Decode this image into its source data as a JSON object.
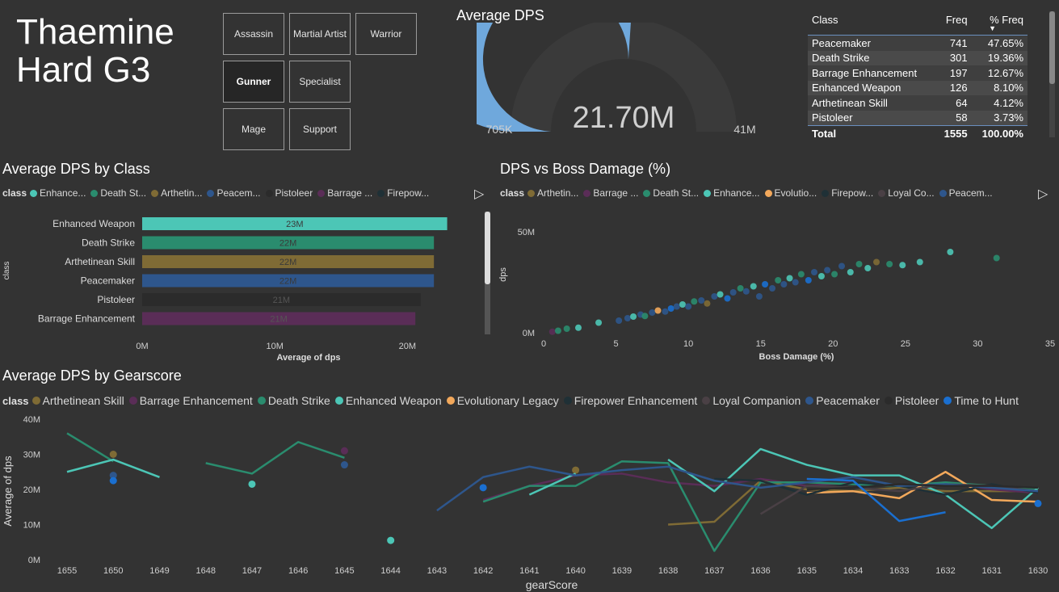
{
  "page_title_line1": "Thaemine",
  "page_title_line2": "Hard G3",
  "slicer": {
    "buttons": [
      {
        "label": "Assassin",
        "selected": false
      },
      {
        "label": "Martial Artist",
        "selected": false
      },
      {
        "label": "Warrior",
        "selected": false
      },
      {
        "label": "Gunner",
        "selected": true
      },
      {
        "label": "Specialist",
        "selected": false
      },
      {
        "label": "Mage",
        "selected": false
      },
      {
        "label": "Support",
        "selected": false
      }
    ]
  },
  "gauge": {
    "title": "Average DPS",
    "value_label": "21.70M",
    "min_label": "705K",
    "max_label": "41M",
    "value": 21700000,
    "min": 705000,
    "max": 41000000,
    "color": "#6fa8dc"
  },
  "freq_table": {
    "headers": [
      "Class",
      "Freq",
      "% Freq"
    ],
    "rows": [
      {
        "class": "Peacemaker",
        "freq": "741",
        "pct": "47.65%"
      },
      {
        "class": "Death Strike",
        "freq": "301",
        "pct": "19.36%"
      },
      {
        "class": "Barrage Enhancement",
        "freq": "197",
        "pct": "12.67%"
      },
      {
        "class": "Enhanced Weapon",
        "freq": "126",
        "pct": "8.10%"
      },
      {
        "class": "Arthetinean Skill",
        "freq": "64",
        "pct": "4.12%"
      },
      {
        "class": "Pistoleer",
        "freq": "58",
        "pct": "3.73%"
      }
    ],
    "total": {
      "label": "Total",
      "freq": "1555",
      "pct": "100.00%"
    }
  },
  "colors": {
    "Arthetinean Skill": "#7f6b35",
    "Barrage Enhancement": "#5a2d57",
    "Death Strike": "#2a8c6e",
    "Enhanced Weapon": "#4cc6b6",
    "Evolutionary Legacy": "#f2a85b",
    "Firepower Enhancement": "#1f3036",
    "Loyal Companion": "#4a4045",
    "Peacemaker": "#2e568c",
    "Pistoleer": "#2b2b2b",
    "Time to Hunt": "#1a6fd0"
  },
  "bar_chart": {
    "title": "Average DPS by Class",
    "legend_title": "class",
    "legend_items": [
      "Enhance...",
      "Death St...",
      "Arthetin...",
      "Peacem...",
      "Pistoleer",
      "Barrage ...",
      "Firepow..."
    ],
    "legend_keys": [
      "Enhanced Weapon",
      "Death Strike",
      "Arthetinean Skill",
      "Peacemaker",
      "Pistoleer",
      "Barrage Enhancement",
      "Firepower Enhancement"
    ]
  },
  "scatter_chart": {
    "title": "DPS vs Boss Damage (%)",
    "legend_title": "class",
    "legend_items": [
      "Arthetin...",
      "Barrage ...",
      "Death St...",
      "Enhance...",
      "Evolutio...",
      "Firepow...",
      "Loyal Co...",
      "Peacem..."
    ],
    "legend_keys": [
      "Arthetinean Skill",
      "Barrage Enhancement",
      "Death Strike",
      "Enhanced Weapon",
      "Evolutionary Legacy",
      "Firepower Enhancement",
      "Loyal Companion",
      "Peacemaker"
    ]
  },
  "line_chart": {
    "title": "Average DPS by Gearscore",
    "legend_title": "class",
    "legend_items": [
      "Arthetinean Skill",
      "Barrage Enhancement",
      "Death Strike",
      "Enhanced Weapon",
      "Evolutionary Legacy",
      "Firepower Enhancement",
      "Loyal Companion",
      "Peacemaker",
      "Pistoleer",
      "Time to Hunt"
    ]
  },
  "chart_data": [
    {
      "type": "bar",
      "orientation": "horizontal",
      "title": "Average DPS by Class",
      "categories": [
        "Enhanced Weapon",
        "Death Strike",
        "Arthetinean Skill",
        "Peacemaker",
        "Pistoleer",
        "Barrage Enhancement"
      ],
      "values": [
        23000000,
        22000000,
        22000000,
        22000000,
        21000000,
        20600000
      ],
      "data_labels": [
        "23M",
        "22M",
        "22M",
        "22M",
        "21M",
        "21M"
      ],
      "xlabel": "Average of dps",
      "ylabel": "class",
      "x_ticks": [
        "0M",
        "10M",
        "20M"
      ],
      "xlim": [
        0,
        24000000
      ]
    },
    {
      "type": "scatter",
      "title": "DPS vs Boss Damage (%)",
      "xlabel": "Boss Damage (%)",
      "ylabel": "dps",
      "xlim": [
        0,
        35
      ],
      "ylim": [
        0,
        50000000
      ],
      "x_ticks": [
        "0",
        "5",
        "10",
        "15",
        "20",
        "25",
        "30",
        "35"
      ],
      "y_ticks": [
        "0M",
        "50M"
      ],
      "points": [
        {
          "x": 0.6,
          "y": 0.5,
          "c": "Barrage Enhancement"
        },
        {
          "x": 1.0,
          "y": 1.0,
          "c": "Death Strike"
        },
        {
          "x": 1.6,
          "y": 2.0,
          "c": "Death Strike"
        },
        {
          "x": 2.4,
          "y": 2.5,
          "c": "Enhanced Weapon"
        },
        {
          "x": 3.8,
          "y": 5.0,
          "c": "Enhanced Weapon"
        },
        {
          "x": 5.2,
          "y": 6.0,
          "c": "Peacemaker"
        },
        {
          "x": 5.8,
          "y": 7.2,
          "c": "Peacemaker"
        },
        {
          "x": 6.2,
          "y": 8.0,
          "c": "Enhanced Weapon"
        },
        {
          "x": 6.7,
          "y": 9.0,
          "c": "Peacemaker"
        },
        {
          "x": 7.0,
          "y": 8.3,
          "c": "Death Strike"
        },
        {
          "x": 7.5,
          "y": 10.0,
          "c": "Peacemaker"
        },
        {
          "x": 7.9,
          "y": 11.0,
          "c": "Evolutionary Legacy"
        },
        {
          "x": 8.4,
          "y": 10.5,
          "c": "Peacemaker"
        },
        {
          "x": 8.8,
          "y": 12.0,
          "c": "Time to Hunt"
        },
        {
          "x": 9.2,
          "y": 13.0,
          "c": "Peacemaker"
        },
        {
          "x": 9.6,
          "y": 14.0,
          "c": "Enhanced Weapon"
        },
        {
          "x": 10.0,
          "y": 13.0,
          "c": "Peacemaker"
        },
        {
          "x": 10.4,
          "y": 15.5,
          "c": "Death Strike"
        },
        {
          "x": 10.9,
          "y": 16.0,
          "c": "Peacemaker"
        },
        {
          "x": 11.3,
          "y": 14.5,
          "c": "Arthetinean Skill"
        },
        {
          "x": 11.8,
          "y": 18.0,
          "c": "Peacemaker"
        },
        {
          "x": 12.2,
          "y": 19.0,
          "c": "Enhanced Weapon"
        },
        {
          "x": 12.7,
          "y": 17.0,
          "c": "Time to Hunt"
        },
        {
          "x": 13.1,
          "y": 20.0,
          "c": "Peacemaker"
        },
        {
          "x": 13.6,
          "y": 22.0,
          "c": "Death Strike"
        },
        {
          "x": 14.0,
          "y": 20.5,
          "c": "Peacemaker"
        },
        {
          "x": 14.5,
          "y": 23.0,
          "c": "Enhanced Weapon"
        },
        {
          "x": 14.9,
          "y": 18.0,
          "c": "Peacemaker"
        },
        {
          "x": 15.3,
          "y": 24.0,
          "c": "Time to Hunt"
        },
        {
          "x": 15.8,
          "y": 22.0,
          "c": "Peacemaker"
        },
        {
          "x": 16.2,
          "y": 26.0,
          "c": "Death Strike"
        },
        {
          "x": 16.6,
          "y": 24.0,
          "c": "Peacemaker"
        },
        {
          "x": 17.0,
          "y": 27.0,
          "c": "Enhanced Weapon"
        },
        {
          "x": 17.4,
          "y": 25.0,
          "c": "Peacemaker"
        },
        {
          "x": 17.8,
          "y": 29.0,
          "c": "Death Strike"
        },
        {
          "x": 18.3,
          "y": 26.0,
          "c": "Time to Hunt"
        },
        {
          "x": 18.7,
          "y": 30.0,
          "c": "Peacemaker"
        },
        {
          "x": 19.2,
          "y": 28.0,
          "c": "Enhanced Weapon"
        },
        {
          "x": 19.6,
          "y": 31.0,
          "c": "Peacemaker"
        },
        {
          "x": 20.1,
          "y": 29.0,
          "c": "Death Strike"
        },
        {
          "x": 20.6,
          "y": 33.0,
          "c": "Peacemaker"
        },
        {
          "x": 21.2,
          "y": 30.0,
          "c": "Enhanced Weapon"
        },
        {
          "x": 21.8,
          "y": 34.0,
          "c": "Death Strike"
        },
        {
          "x": 22.4,
          "y": 32.0,
          "c": "Enhanced Weapon"
        },
        {
          "x": 23.0,
          "y": 35.0,
          "c": "Arthetinean Skill"
        },
        {
          "x": 23.9,
          "y": 34.0,
          "c": "Death Strike"
        },
        {
          "x": 24.8,
          "y": 33.5,
          "c": "Enhanced Weapon"
        },
        {
          "x": 26.0,
          "y": 35.0,
          "c": "Enhanced Weapon"
        },
        {
          "x": 28.1,
          "y": 40.0,
          "c": "Enhanced Weapon"
        },
        {
          "x": 31.3,
          "y": 37.0,
          "c": "Death Strike"
        }
      ]
    },
    {
      "type": "line",
      "title": "Average DPS by Gearscore",
      "xlabel": "gearScore",
      "ylabel": "Average of dps",
      "categories": [
        "1655",
        "1650",
        "1649",
        "1648",
        "1647",
        "1646",
        "1645",
        "1644",
        "1643",
        "1642",
        "1641",
        "1640",
        "1639",
        "1638",
        "1637",
        "1636",
        "1635",
        "1634",
        "1633",
        "1632",
        "1631",
        "1630"
      ],
      "ylim": [
        0,
        40
      ],
      "y_ticks": [
        "0M",
        "10M",
        "20M",
        "30M",
        "40M"
      ],
      "series": [
        {
          "name": "Arthetinean Skill",
          "values": [
            null,
            30,
            null,
            null,
            null,
            null,
            null,
            null,
            null,
            null,
            null,
            25.5,
            null,
            10,
            10.8,
            22.5,
            20,
            19.5,
            20.5,
            19.5,
            19.5,
            19.5
          ]
        },
        {
          "name": "Barrage Enhancement",
          "values": [
            null,
            null,
            null,
            null,
            null,
            null,
            31,
            null,
            null,
            17,
            21,
            24,
            24.5,
            22,
            21,
            23,
            21,
            22,
            21,
            22,
            20,
            19
          ]
        },
        {
          "name": "Death Strike",
          "values": [
            36,
            28,
            null,
            27.5,
            24.5,
            33.5,
            29,
            null,
            null,
            16.5,
            21,
            21,
            28,
            27.5,
            2.5,
            22,
            22,
            21.5,
            21,
            22,
            21,
            20
          ]
        },
        {
          "name": "Enhanced Weapon",
          "values": [
            25,
            28.5,
            23.5,
            null,
            21.5,
            null,
            null,
            5.5,
            null,
            null,
            18.5,
            24.5,
            null,
            28.5,
            19.5,
            31.5,
            27,
            24,
            24,
            18.5,
            9,
            20.5
          ]
        },
        {
          "name": "Evolutionary Legacy",
          "values": [
            null,
            null,
            null,
            null,
            null,
            null,
            null,
            null,
            null,
            null,
            null,
            null,
            null,
            null,
            null,
            null,
            19,
            19.5,
            17.5,
            25,
            17,
            16.5
          ]
        },
        {
          "name": "Firepower Enhancement",
          "values": [
            null,
            null,
            null,
            null,
            null,
            null,
            null,
            null,
            null,
            null,
            null,
            null,
            null,
            null,
            23,
            22.5,
            18.5,
            22,
            21,
            18.5,
            21.5,
            19
          ]
        },
        {
          "name": "Loyal Companion",
          "values": [
            null,
            null,
            null,
            null,
            null,
            null,
            null,
            null,
            null,
            null,
            null,
            null,
            null,
            null,
            null,
            13,
            21,
            20.5,
            19.5,
            21.5,
            21,
            19.5
          ]
        },
        {
          "name": "Peacemaker",
          "values": [
            null,
            24,
            null,
            null,
            null,
            null,
            27,
            null,
            14,
            23.5,
            26.5,
            24,
            25.5,
            26.5,
            22.5,
            20.5,
            22,
            23.5,
            21,
            21.5,
            20.5,
            19.5
          ]
        },
        {
          "name": "Pistoleer",
          "values": [
            null,
            null,
            null,
            null,
            null,
            null,
            null,
            null,
            null,
            null,
            null,
            null,
            null,
            null,
            null,
            null,
            20,
            20.5,
            21.5,
            21,
            21,
            20.5
          ]
        },
        {
          "name": "Time to Hunt",
          "values": [
            null,
            22.5,
            null,
            null,
            null,
            null,
            null,
            null,
            null,
            20.5,
            null,
            null,
            null,
            null,
            null,
            null,
            23,
            22.5,
            11,
            13.5,
            null,
            16
          ]
        }
      ]
    }
  ]
}
